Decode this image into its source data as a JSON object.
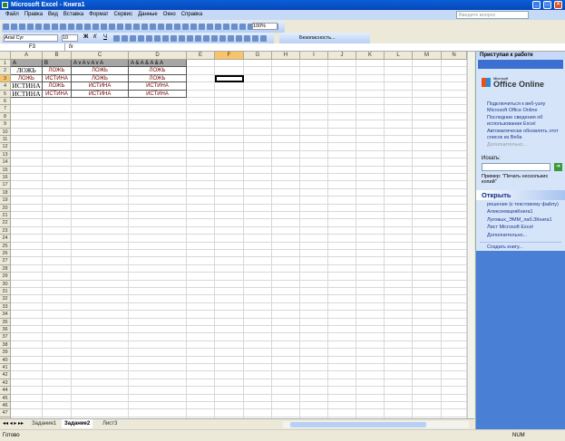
{
  "window": {
    "title": "Microsoft Excel - Книга1"
  },
  "menu": [
    "Файл",
    "Правка",
    "Вид",
    "Вставка",
    "Формат",
    "Сервис",
    "Данные",
    "Окно",
    "Справка"
  ],
  "ask_placeholder": "Введите вопрос",
  "toolbar": {
    "zoom": "100%",
    "font": "Arial Cyr",
    "size": "10",
    "bold": "Ж",
    "italic": "К",
    "underline": "Ч",
    "security": "Безопасность..."
  },
  "formula_bar": {
    "name_box": "F3",
    "fx": "fx",
    "value": ""
  },
  "columns": [
    "A",
    "B",
    "C",
    "D",
    "E",
    "F",
    "G",
    "H",
    "I",
    "J",
    "K",
    "L",
    "M",
    "N"
  ],
  "cells": [
    [
      "A",
      "B",
      "A v A v A v A",
      "A & A & A & A"
    ],
    [
      "ЛОЖЬ",
      "ЛОЖЬ",
      "ЛОЖЬ",
      "ЛОЖЬ"
    ],
    [
      "ЛОЖЬ",
      "ИСТИНА",
      "ЛОЖЬ",
      "ЛОЖЬ"
    ],
    [
      "ИСТИНА",
      "ЛОЖЬ",
      "ИСТИНА",
      "ИСТИНА"
    ],
    [
      "ИСТИНА",
      "ИСТИНА",
      "ИСТИНА",
      "ИСТИНА"
    ]
  ],
  "active_cell": "F3",
  "sheets": [
    {
      "name": "Задание1",
      "active": false
    },
    {
      "name": "Задание2",
      "active": true
    },
    {
      "name": "Лист3",
      "active": false
    }
  ],
  "status": {
    "left": "Готово",
    "num": "NUM"
  },
  "task_pane": {
    "title": "Приступая к работе",
    "logo_small": "Microsoft",
    "logo": "Office Online",
    "links": [
      "Подключиться к веб-узлу Microsoft Office Online",
      "Последние сведения об использовании Excel",
      "Автоматически обновлять этот список из Веба"
    ],
    "more": "Дополнительно...",
    "search_label": "Искать:",
    "example": "Пример: \"Печать нескольких копий\"",
    "open_title": "Открыть",
    "files": [
      "решение (к текстовому файлу)",
      "АлексеевцевКнига1",
      "Луговых_ЭММ_лаб.3Книга1",
      "Лист Microsoft Excel"
    ],
    "open_more": "Дополнительно...",
    "create": "Создать книгу..."
  },
  "colors": {
    "title": "#0a5fd8",
    "header_row": "#a6a6a6",
    "active_header": "#f8c46a",
    "pane": "#d6e4fa"
  }
}
